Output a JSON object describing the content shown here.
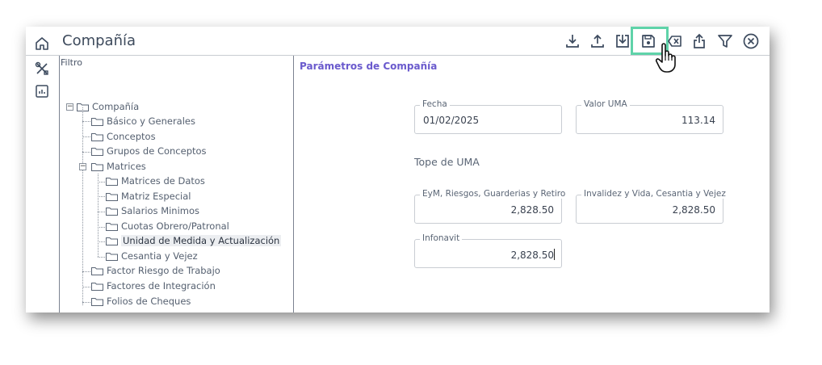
{
  "window": {
    "title": "Compañía"
  },
  "rail": {
    "icons": [
      "home-icon",
      "tools-icon",
      "chart-icon"
    ]
  },
  "toolbar": {
    "icons": [
      "download-icon",
      "upload-icon",
      "import-icon",
      "save-icon",
      "clear-icon",
      "share-icon",
      "filter-icon",
      "close-icon"
    ],
    "highlighted": "save-icon",
    "highlight_color": "#5fd3a9"
  },
  "tree": {
    "filter_label": "Filtro",
    "root": "Compañía",
    "items": [
      "Básico y Generales",
      "Conceptos",
      "Grupos de Conceptos",
      "Matrices",
      "Factor Riesgo de Trabajo",
      "Factores de Integración",
      "Folios de Cheques"
    ],
    "matrices_children": [
      "Matrices de Datos",
      "Matriz Especial",
      "Salarios Minimos",
      "Cuotas Obrero/Patronal",
      "Unidad de Medida y Actualización",
      "Cesantia y Vejez"
    ],
    "selected": "Unidad de Medida y Actualización"
  },
  "form": {
    "title": "Parámetros de Compañía",
    "title_color": "#6a5acd",
    "fecha": {
      "label": "Fecha",
      "value": "01/02/2025"
    },
    "valor_uma": {
      "label": "Valor UMA",
      "value": "113.14"
    },
    "tope_title": "Tope de UMA",
    "eym": {
      "label": "EyM, Riesgos, Guarderias y Retiro",
      "value": "2,828.50"
    },
    "invalidez": {
      "label": "Invalidez y Vida, Cesantia y Vejez",
      "value": "2,828.50"
    },
    "infonavit": {
      "label": "Infonavit",
      "value": "2,828.50"
    }
  }
}
